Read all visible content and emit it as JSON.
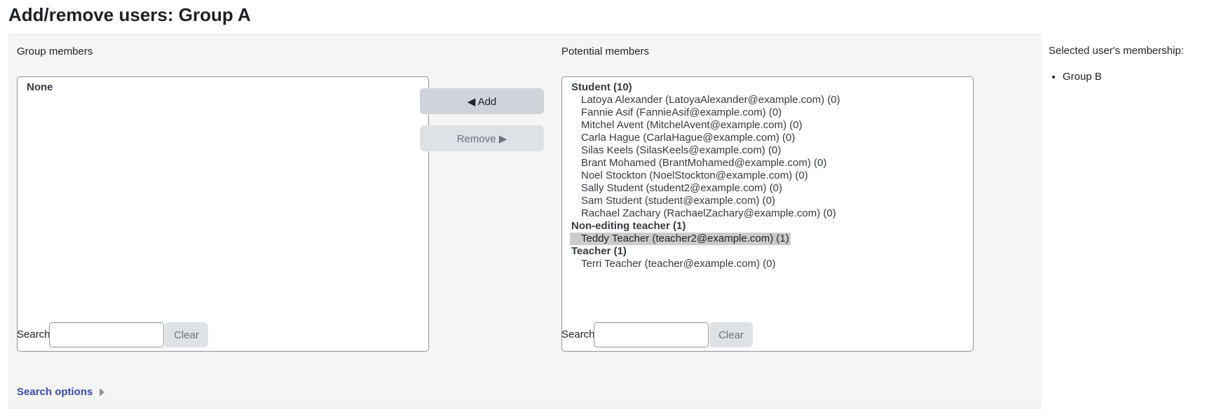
{
  "page": {
    "title": "Add/remove users: Group A"
  },
  "group_members": {
    "label": "Group members",
    "empty_label": "None",
    "search_label": "Search",
    "search_value": "",
    "clear_label": "Clear",
    "search_options_label": "Search options"
  },
  "actions": {
    "add_label": "◀ Add",
    "remove_label": "Remove ▶"
  },
  "potential_members": {
    "label": "Potential members",
    "groups": [
      {
        "label": "Student (10)",
        "options": [
          {
            "text": "Latoya Alexander (LatoyaAlexander@example.com) (0)",
            "selected": false
          },
          {
            "text": "Fannie Asif (FannieAsif@example.com) (0)",
            "selected": false
          },
          {
            "text": "Mitchel Avent (MitchelAvent@example.com) (0)",
            "selected": false
          },
          {
            "text": "Carla Hague (CarlaHague@example.com) (0)",
            "selected": false
          },
          {
            "text": "Silas Keels (SilasKeels@example.com) (0)",
            "selected": false
          },
          {
            "text": "Brant Mohamed (BrantMohamed@example.com) (0)",
            "selected": false
          },
          {
            "text": "Noel Stockton (NoelStockton@example.com) (0)",
            "selected": false
          },
          {
            "text": "Sally Student (student2@example.com) (0)",
            "selected": false
          },
          {
            "text": "Sam Student (student@example.com) (0)",
            "selected": false
          },
          {
            "text": "Rachael Zachary (RachaelZachary@example.com) (0)",
            "selected": false
          }
        ]
      },
      {
        "label": "Non-editing teacher (1)",
        "options": [
          {
            "text": "Teddy Teacher (teacher2@example.com) (1)",
            "selected": true
          }
        ]
      },
      {
        "label": "Teacher (1)",
        "options": [
          {
            "text": "Terri Teacher (teacher@example.com) (0)",
            "selected": false
          }
        ]
      }
    ],
    "search_label": "Search",
    "search_value": "",
    "clear_label": "Clear"
  },
  "membership": {
    "label": "Selected user's membership:",
    "items": [
      "Group B"
    ]
  }
}
